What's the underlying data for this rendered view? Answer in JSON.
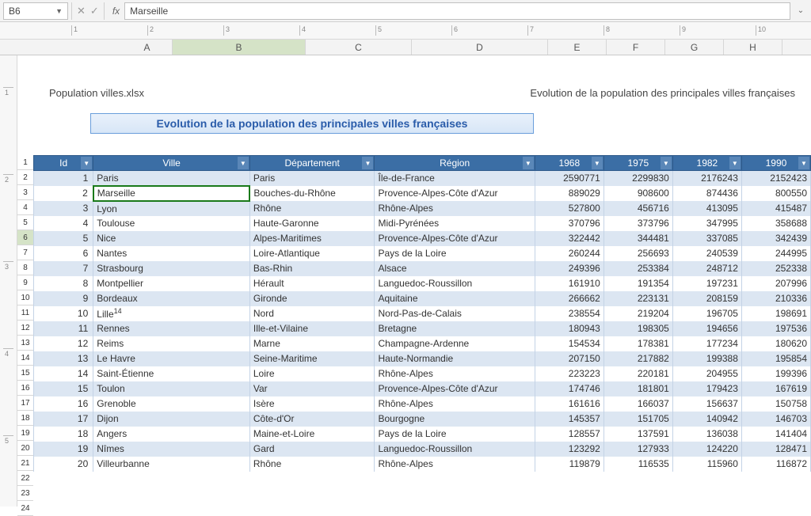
{
  "namebox": "B6",
  "fx_label": "fx",
  "formula_value": "Marseille",
  "col_letters": [
    "A",
    "B",
    "C",
    "D",
    "E",
    "F",
    "G",
    "H"
  ],
  "selected_col_index": 1,
  "page_header": {
    "filename": "Population villes.xlsx",
    "doctitle": "Evolution de la population des principales villes françaises"
  },
  "title_banner": "Evolution de la population des principales villes françaises",
  "headers": [
    "Id",
    "Ville",
    "Département",
    "Région",
    "1968",
    "1975",
    "1982",
    "1990"
  ],
  "row_numbers_visible": [
    "1",
    "2",
    "3",
    "4",
    "5",
    "6",
    "7",
    "8",
    "9",
    "10",
    "11",
    "12",
    "13",
    "14",
    "15",
    "16",
    "17",
    "18",
    "19",
    "20",
    "21",
    "22",
    "23",
    "24"
  ],
  "selected_row_number": "6",
  "selected_cell_value": "Marseille",
  "rows": [
    {
      "id": "1",
      "ville": "Paris",
      "dep": "Paris",
      "reg": "Île-de-France",
      "y1968": "2590771",
      "y1975": "2299830",
      "y1982": "2176243",
      "y1990": "2152423"
    },
    {
      "id": "2",
      "ville": "Marseille",
      "dep": "Bouches-du-Rhône",
      "reg": "Provence-Alpes-Côte d'Azur",
      "y1968": "889029",
      "y1975": "908600",
      "y1982": "874436",
      "y1990": "800550"
    },
    {
      "id": "3",
      "ville": "Lyon",
      "dep": "Rhône",
      "reg": "Rhône-Alpes",
      "y1968": "527800",
      "y1975": "456716",
      "y1982": "413095",
      "y1990": "415487"
    },
    {
      "id": "4",
      "ville": "Toulouse",
      "dep": "Haute-Garonne",
      "reg": "Midi-Pyrénées",
      "y1968": "370796",
      "y1975": "373796",
      "y1982": "347995",
      "y1990": "358688"
    },
    {
      "id": "5",
      "ville": "Nice",
      "dep": "Alpes-Maritimes",
      "reg": "Provence-Alpes-Côte d'Azur",
      "y1968": "322442",
      "y1975": "344481",
      "y1982": "337085",
      "y1990": "342439"
    },
    {
      "id": "6",
      "ville": "Nantes",
      "dep": "Loire-Atlantique",
      "reg": "Pays de la Loire",
      "y1968": "260244",
      "y1975": "256693",
      "y1982": "240539",
      "y1990": "244995"
    },
    {
      "id": "7",
      "ville": "Strasbourg",
      "dep": "Bas-Rhin",
      "reg": "Alsace",
      "y1968": "249396",
      "y1975": "253384",
      "y1982": "248712",
      "y1990": "252338"
    },
    {
      "id": "8",
      "ville": "Montpellier",
      "dep": "Hérault",
      "reg": "Languedoc-Roussillon",
      "y1968": "161910",
      "y1975": "191354",
      "y1982": "197231",
      "y1990": "207996"
    },
    {
      "id": "9",
      "ville": "Bordeaux",
      "dep": "Gironde",
      "reg": "Aquitaine",
      "y1968": "266662",
      "y1975": "223131",
      "y1982": "208159",
      "y1990": "210336"
    },
    {
      "id": "10",
      "ville": "Lille",
      "ville_sup": "14",
      "dep": "Nord",
      "reg": "Nord-Pas-de-Calais",
      "y1968": "238554",
      "y1975": "219204",
      "y1982": "196705",
      "y1990": "198691"
    },
    {
      "id": "11",
      "ville": "Rennes",
      "dep": "Ille-et-Vilaine",
      "reg": "Bretagne",
      "y1968": "180943",
      "y1975": "198305",
      "y1982": "194656",
      "y1990": "197536"
    },
    {
      "id": "12",
      "ville": "Reims",
      "dep": "Marne",
      "reg": "Champagne-Ardenne",
      "y1968": "154534",
      "y1975": "178381",
      "y1982": "177234",
      "y1990": "180620"
    },
    {
      "id": "13",
      "ville": "Le Havre",
      "dep": "Seine-Maritime",
      "reg": "Haute-Normandie",
      "y1968": "207150",
      "y1975": "217882",
      "y1982": "199388",
      "y1990": "195854"
    },
    {
      "id": "14",
      "ville": "Saint-Étienne",
      "dep": "Loire",
      "reg": "Rhône-Alpes",
      "y1968": "223223",
      "y1975": "220181",
      "y1982": "204955",
      "y1990": "199396"
    },
    {
      "id": "15",
      "ville": "Toulon",
      "dep": "Var",
      "reg": "Provence-Alpes-Côte d'Azur",
      "y1968": "174746",
      "y1975": "181801",
      "y1982": "179423",
      "y1990": "167619"
    },
    {
      "id": "16",
      "ville": "Grenoble",
      "dep": "Isère",
      "reg": "Rhône-Alpes",
      "y1968": "161616",
      "y1975": "166037",
      "y1982": "156637",
      "y1990": "150758"
    },
    {
      "id": "17",
      "ville": "Dijon",
      "dep": "Côte-d'Or",
      "reg": "Bourgogne",
      "y1968": "145357",
      "y1975": "151705",
      "y1982": "140942",
      "y1990": "146703"
    },
    {
      "id": "18",
      "ville": "Angers",
      "dep": "Maine-et-Loire",
      "reg": "Pays de la Loire",
      "y1968": "128557",
      "y1975": "137591",
      "y1982": "136038",
      "y1990": "141404"
    },
    {
      "id": "19",
      "ville": "Nîmes",
      "dep": "Gard",
      "reg": "Languedoc-Roussillon",
      "y1968": "123292",
      "y1975": "127933",
      "y1982": "124220",
      "y1990": "128471"
    },
    {
      "id": "20",
      "ville": "Villeurbanne",
      "dep": "Rhône",
      "reg": "Rhône-Alpes",
      "y1968": "119879",
      "y1975": "116535",
      "y1982": "115960",
      "y1990": "116872"
    }
  ],
  "hruler_labels": [
    "1",
    "2",
    "3",
    "4",
    "5",
    "6",
    "7",
    "8",
    "9",
    "10"
  ],
  "vruler_labels": [
    "1",
    "2",
    "3",
    "4",
    "5"
  ]
}
